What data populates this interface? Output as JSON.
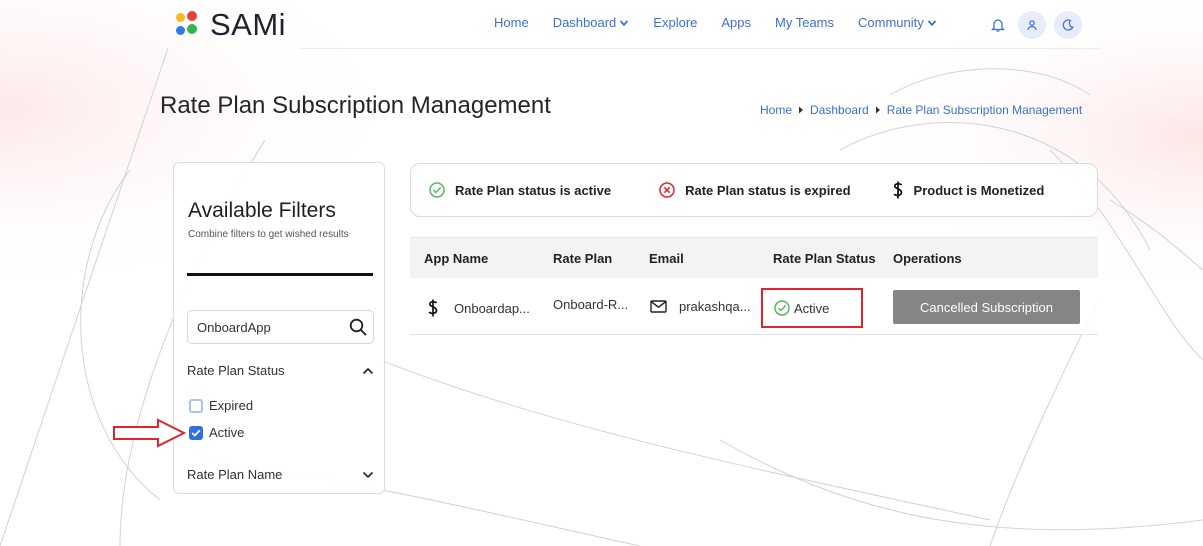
{
  "header": {
    "logo_text": "SAMi",
    "nav": [
      "Home",
      "Dashboard",
      "Explore",
      "Apps",
      "My Teams",
      "Community"
    ]
  },
  "page": {
    "title": "Rate Plan Subscription Management",
    "breadcrumb": [
      "Home",
      "Dashboard",
      "Rate Plan Subscription Management"
    ]
  },
  "filters": {
    "title": "Available Filters",
    "subtitle": "Combine filters to get wished results",
    "search_value": "OnboardApp",
    "section_status": "Rate Plan Status",
    "options": [
      {
        "label": "Expired",
        "checked": false
      },
      {
        "label": "Active",
        "checked": true
      }
    ],
    "section_name": "Rate Plan Name"
  },
  "legend": {
    "active": "Rate Plan status is active",
    "expired": "Rate Plan status is expired",
    "monetized": "Product is Monetized"
  },
  "table": {
    "headers": [
      "App Name",
      "Rate Plan",
      "Email",
      "Rate Plan Status",
      "Operations"
    ],
    "rows": [
      {
        "app_name": "Onboardap...",
        "rate_plan": "Onboard-R...",
        "email": "prakashqa...",
        "status": "Active",
        "operation": "Cancelled Subscription"
      }
    ]
  },
  "colors": {
    "accent": "#3b6fd9",
    "active_green": "#5cb85c",
    "expired_red": "#e0262c",
    "highlight_border": "#e0262c",
    "button_gray": "#858585"
  }
}
